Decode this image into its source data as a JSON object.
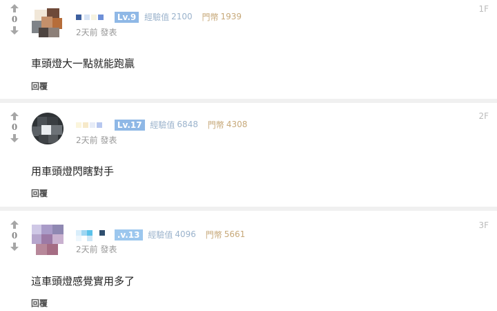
{
  "comments": [
    {
      "floor": "1F",
      "votes": "0",
      "level": "Lv.9",
      "exp_label": "經驗值",
      "exp_value": "2100",
      "coin_label": "門幣",
      "coin_value": "1939",
      "time": "2天前 發表",
      "content": "車頭燈大一點就能跑贏",
      "reply_label": "回覆",
      "level_color": "#8fb8e6"
    },
    {
      "floor": "2F",
      "votes": "0",
      "level": "Lv.17",
      "exp_label": "經驗值",
      "exp_value": "6848",
      "coin_label": "門幣",
      "coin_value": "4308",
      "time": "2天前 發表",
      "content": "用車頭燈閃瞎對手",
      "reply_label": "回覆",
      "level_color": "#8fb8e6"
    },
    {
      "floor": "3F",
      "votes": "0",
      "level": ".v.13",
      "exp_label": "經驗值",
      "exp_value": "4096",
      "coin_label": "門幣",
      "coin_value": "5661",
      "time": "2天前 發表",
      "content": "這車頭燈感覺實用多了",
      "reply_label": "回覆",
      "level_color": "#9cc7ee"
    }
  ],
  "colors": {
    "exp": "#9bb3cc",
    "coin": "#c7a97a"
  },
  "icons": {
    "up": "up-arrow-icon",
    "down": "down-arrow-icon"
  }
}
